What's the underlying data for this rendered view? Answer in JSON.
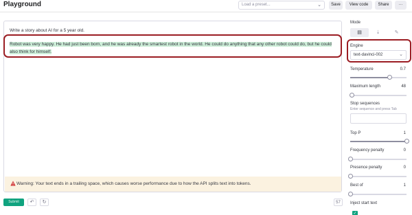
{
  "header": {
    "title": "Playground",
    "preset_placeholder": "Load a preset...",
    "save_label": "Save",
    "view_code_label": "View code",
    "share_label": "Share",
    "more_label": "···"
  },
  "editor": {
    "prompt": "Write a story about AI for a 5 year old.",
    "completion": "Robot was very happy. He had just been born, and he was already the smartest robot in the world. He could do anything that any other robot could do, but he could also think for himself.",
    "warning": "Warning: Your text ends in a trailing space, which causes worse performance due to how the API splits text into tokens."
  },
  "footer": {
    "submit_label": "Submit",
    "token_count": "57"
  },
  "sidebar": {
    "mode_label": "Mode",
    "engine_label": "Engine",
    "engine_value": "text-davinci-002",
    "temperature": {
      "label": "Temperature",
      "value": "0.7",
      "fraction": 0.7
    },
    "max_length": {
      "label": "Maximum length",
      "value": "48",
      "fraction": 0.02
    },
    "stop_sequences": {
      "label": "Stop sequences",
      "hint": "Enter sequence and press Tab"
    },
    "top_p": {
      "label": "Top P",
      "value": "1",
      "fraction": 1
    },
    "frequency_penalty": {
      "label": "Frequency penalty",
      "value": "0",
      "fraction": 0
    },
    "presence_penalty": {
      "label": "Presence penalty",
      "value": "0",
      "fraction": 0
    },
    "best_of": {
      "label": "Best of",
      "value": "1",
      "fraction": 0
    },
    "inject_start_label": "Inject start text"
  },
  "colors": {
    "accent": "#10a37f",
    "highlight_box": "#9b1c22",
    "completion_highlight": "#cdeed8",
    "warning_bg": "#fbf2e0"
  },
  "icons": [
    "chevron-down-icon",
    "ellipsis-icon",
    "warning-icon",
    "undo-icon",
    "regenerate-icon",
    "complete-mode-icon",
    "insert-mode-icon",
    "edit-mode-icon",
    "check-icon"
  ]
}
